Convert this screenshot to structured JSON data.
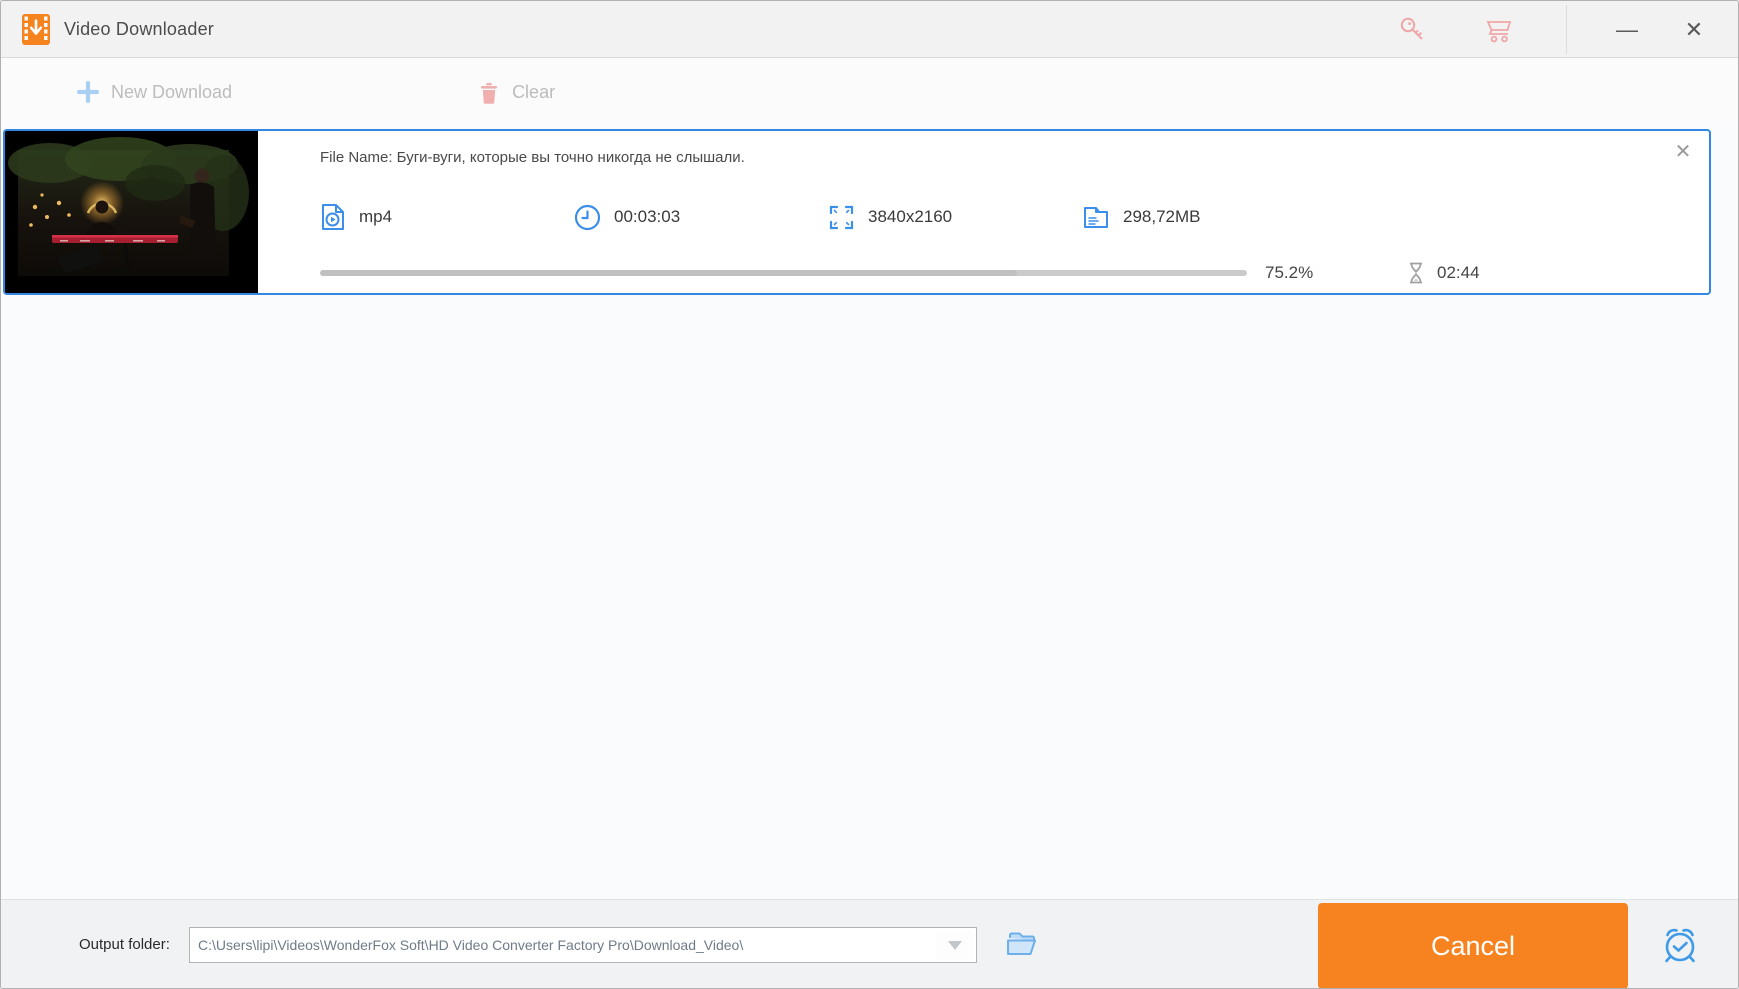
{
  "titlebar": {
    "title": "Video Downloader",
    "minimize_glyph": "—",
    "close_glyph": "✕"
  },
  "toolbar": {
    "new_download_label": "New Download",
    "clear_label": "Clear"
  },
  "download_item": {
    "file_name_line": "File Name: Буги-вуги, которые вы точно никогда не слышали.",
    "format": "mp4",
    "duration": "00:03:03",
    "resolution": "3840x2160",
    "file_size": "298,72MB",
    "progress_percent": "75.2%",
    "progress_value": 75.2,
    "progress_fill_style": "width:75.2%",
    "time_remaining": "02:44",
    "close_glyph": "✕"
  },
  "footer": {
    "output_folder_label": "Output folder:",
    "output_path": "C:\\Users\\lipi\\Videos\\WonderFox Soft\\HD Video Converter Factory Pro\\Download_Video\\",
    "cancel_label": "Cancel"
  },
  "icons": {
    "app": "film-strip-download",
    "register": "key",
    "store": "shopping-cart",
    "new_download": "plus",
    "clear": "trash",
    "format": "video-file-play",
    "duration": "clock",
    "resolution": "fullscreen-corners",
    "file_size": "document-folder",
    "eta": "hourglass",
    "browse": "open-folder",
    "schedule": "alarm-clock"
  },
  "colors": {
    "accent_orange": "#f6831f",
    "accent_blue": "#3b8ee9",
    "card_border_blue": "#3387e2",
    "salmon_icons": "#efa6a6",
    "disabled_text": "#bcbcbc",
    "progress_gray": "#cbcbcb"
  }
}
